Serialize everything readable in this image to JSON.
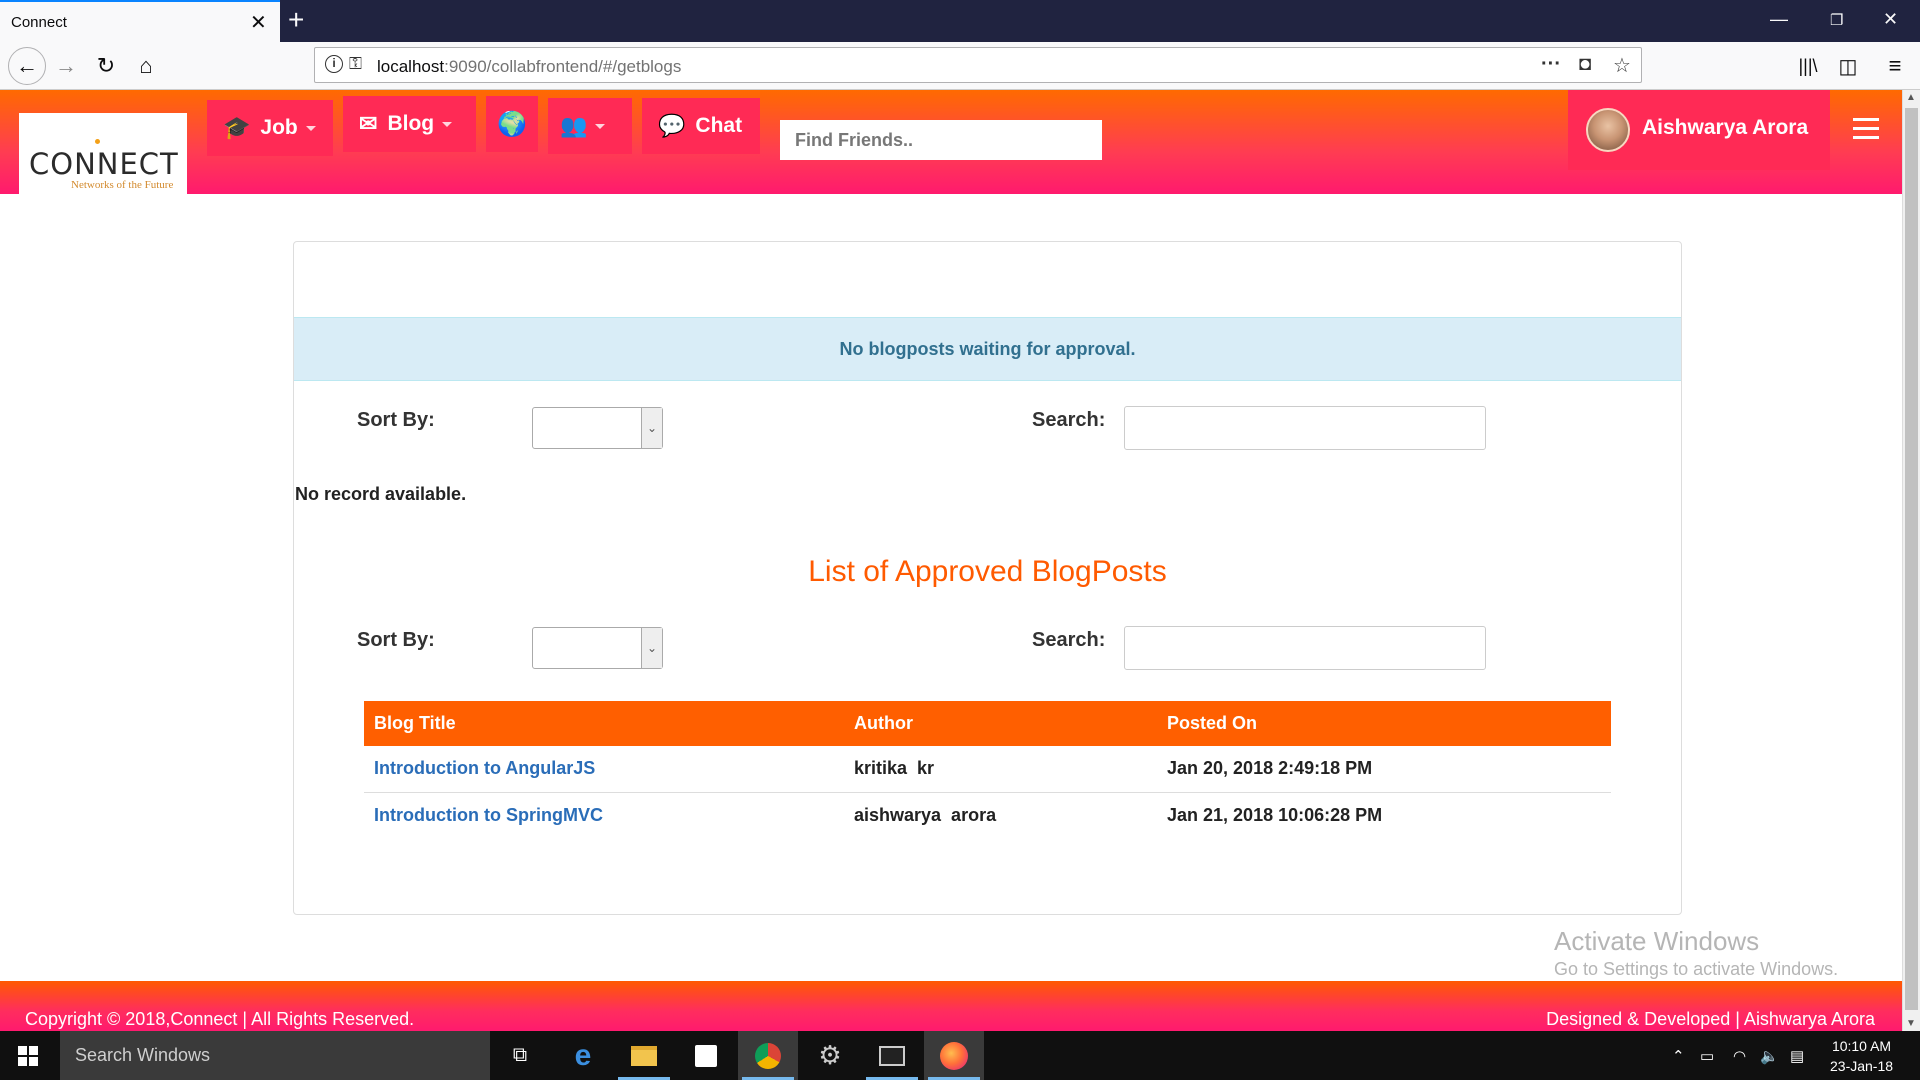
{
  "browser": {
    "tab_title": "Connect",
    "url_host": "localhost",
    "url_rest": ":9090/collabfrontend/#/getblogs"
  },
  "header": {
    "logo_text": "CONNECT",
    "logo_tagline": "Networks of the Future",
    "nav": {
      "job": "Job",
      "blog": "Blog",
      "chat": "Chat"
    },
    "find_placeholder": "Find Friends..",
    "user_name": "Aishwarya Arora"
  },
  "pending": {
    "alert": "No blogposts waiting for approval.",
    "sort_label": "Sort By:",
    "search_label": "Search:",
    "empty_text": "No record available."
  },
  "approved": {
    "title": "List of Approved BlogPosts",
    "sort_label": "Sort By:",
    "search_label": "Search:",
    "columns": [
      "Blog Title",
      "Author",
      "Posted On"
    ],
    "rows": [
      {
        "title": "Introduction to AngularJS",
        "author": "kritika  kr",
        "posted": "Jan 20, 2018 2:49:18 PM"
      },
      {
        "title": "Introduction to SpringMVC",
        "author": "aishwarya  arora",
        "posted": "Jan 21, 2018 10:06:28 PM"
      }
    ]
  },
  "watermark": {
    "line1": "Activate Windows",
    "line2": "Go to Settings to activate Windows."
  },
  "footer": {
    "left": "Copyright © 2018,Connect | All Rights Reserved.",
    "right": "Designed & Developed | Aishwarya Arora"
  },
  "taskbar": {
    "search_placeholder": "Search Windows",
    "time": "10:10 AM",
    "date": "23-Jan-18"
  },
  "colors": {
    "accent": "#ff5f00",
    "header_pink": "#ff1a6e",
    "link": "#2a6db8",
    "alert_bg": "#d9edf7"
  }
}
